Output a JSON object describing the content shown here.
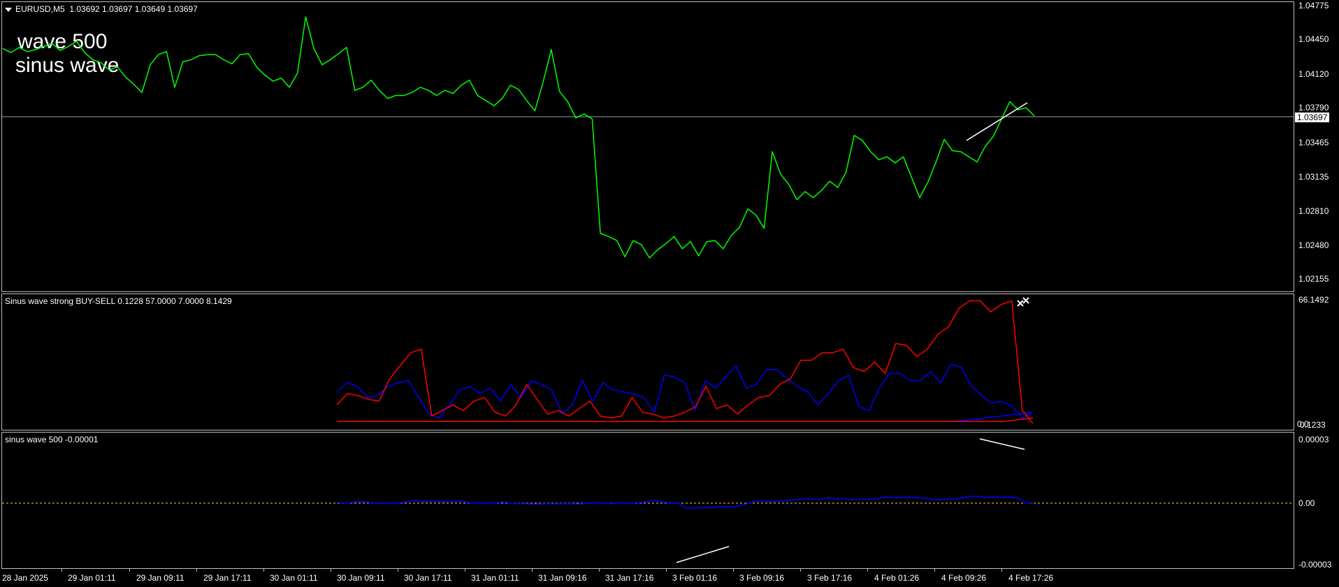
{
  "main_chart": {
    "symbol_info": "EURUSD,M5  1.03692 1.03697 1.03649 1.03697",
    "overlay_text": [
      "wave 500",
      "sinus wave"
    ],
    "current_price": "1.03697",
    "price_levels": [
      "1.04775",
      "1.04450",
      "1.04120",
      "1.03790",
      "1.03465",
      "1.03135",
      "1.02810",
      "1.02480",
      "1.02155"
    ]
  },
  "indicator_1": {
    "label": "Sinus wave strong BUY-SELL 0.1228 57.0000 7.0000 8.1429",
    "scale_top": "66.1492",
    "scale_bottom": "0.1233",
    "scale_bottom_overlap": "0.0"
  },
  "indicator_2": {
    "label": "sinus wave 500 -0.00001",
    "scale": [
      "0.00003",
      "0.00",
      "-0.00003"
    ]
  },
  "time_axis": [
    "28 Jan 2025",
    "29 Jan 01:11",
    "29 Jan 09:11",
    "29 Jan 17:11",
    "30 Jan 01:11",
    "30 Jan 09:11",
    "30 Jan 17:11",
    "31 Jan 01:11",
    "31 Jan 09:16",
    "31 Jan 17:16",
    "3 Feb 01:16",
    "3 Feb 09:16",
    "3 Feb 17:16",
    "4 Feb 01:26",
    "4 Feb 09:26",
    "4 Feb 17:26"
  ],
  "colors": {
    "price_line": "#00ff00",
    "buy_line": "#0000ff",
    "sell_line": "#ff0000",
    "sinus_line": "#0000ff",
    "zero_line": "#ffd24d",
    "grid_border": "#bfbfbf"
  },
  "chart_data": [
    {
      "type": "line",
      "title": "EURUSD,M5",
      "ylim": [
        1.0203,
        1.0478
      ],
      "series": [
        {
          "name": "EURUSD",
          "values": [
            1.0436,
            1.0432,
            1.0437,
            1.0433,
            1.0435,
            1.0438,
            1.0441,
            1.0434,
            1.0438,
            1.0443,
            1.0432,
            1.0425,
            1.0422,
            1.0415,
            1.0418,
            1.0408,
            1.0401,
            1.0393,
            1.042,
            1.043,
            1.0433,
            1.0398,
            1.0423,
            1.0425,
            1.0429,
            1.043,
            1.043,
            1.0425,
            1.0421,
            1.043,
            1.0431,
            1.0418,
            1.041,
            1.0404,
            1.0407,
            1.0398,
            1.0412,
            1.0467,
            1.0436,
            1.042,
            1.0425,
            1.0431,
            1.0437,
            1.0395,
            1.0398,
            1.0405,
            1.0395,
            1.0387,
            1.039,
            1.039,
            1.0393,
            1.0398,
            1.0395,
            1.039,
            1.0395,
            1.0392,
            1.04,
            1.0405,
            1.039,
            1.0385,
            1.038,
            1.0387,
            1.04,
            1.0396,
            1.0385,
            1.0375,
            1.0403,
            1.0435,
            1.0394,
            1.0384,
            1.0368,
            1.0372,
            1.0367,
            1.0255,
            1.0252,
            1.0248,
            1.0232,
            1.0248,
            1.0244,
            1.0231,
            1.0239,
            1.0245,
            1.0252,
            1.024,
            1.0247,
            1.0233,
            1.0247,
            1.0248,
            1.024,
            1.0253,
            1.0261,
            1.0279,
            1.0273,
            1.026,
            1.0335,
            1.0313,
            1.0303,
            1.0288,
            1.0296,
            1.029,
            1.0297,
            1.0306,
            1.03,
            1.0315,
            1.0351,
            1.0346,
            1.0335,
            1.0327,
            1.033,
            1.0324,
            1.033,
            1.031,
            1.029,
            1.0305,
            1.0325,
            1.0347,
            1.0336,
            1.0335,
            1.033,
            1.0325,
            1.034,
            1.035,
            1.0367,
            1.0384,
            1.0376,
            1.0378,
            1.037
          ]
        }
      ]
    },
    {
      "type": "line",
      "title": "Sinus wave strong BUY-SELL",
      "ylim": [
        0,
        66.1492
      ],
      "series": [
        {
          "name": "blue",
          "values": [
            17,
            22,
            20,
            14,
            15,
            20,
            22,
            23,
            14,
            5,
            3,
            10,
            18,
            20,
            16,
            19,
            12,
            21,
            14,
            23,
            21,
            18,
            5,
            10,
            23,
            12,
            22,
            18,
            17,
            16,
            14,
            6,
            26,
            25,
            22,
            7,
            23,
            19,
            25,
            31,
            19,
            21,
            29,
            29,
            24,
            20,
            17,
            10,
            16,
            23,
            26,
            9,
            7,
            19,
            27,
            27,
            23,
            23,
            28,
            22,
            32,
            30,
            20,
            15,
            11,
            12,
            9,
            3,
            6
          ]
        },
        {
          "name": "red",
          "values": [
            10,
            16,
            15,
            13,
            12,
            24,
            31,
            38,
            40,
            4,
            7,
            10,
            7,
            12,
            14,
            6,
            4,
            10,
            21,
            13,
            5,
            7,
            4,
            8,
            12,
            4,
            3,
            4,
            14,
            6,
            5,
            3,
            4,
            6,
            9,
            20,
            8,
            10,
            5,
            10,
            14,
            15,
            21,
            24,
            34,
            34,
            38,
            38,
            40,
            30,
            28,
            33,
            27,
            43,
            42,
            36,
            40,
            48,
            52,
            62,
            66,
            66,
            60,
            64,
            66,
            7,
            0
          ]
        },
        {
          "name": "blue-base",
          "values": [
            1,
            1,
            1,
            1,
            1,
            1,
            1,
            1,
            1,
            1,
            1,
            1,
            1,
            1,
            1,
            1,
            1,
            1,
            1,
            1,
            1,
            1,
            1,
            1,
            1,
            1,
            1,
            1,
            1,
            1,
            1,
            1,
            1,
            1,
            1,
            1,
            1,
            1,
            1,
            1,
            2,
            3,
            4,
            5,
            6
          ]
        },
        {
          "name": "red-base",
          "values": [
            1,
            1,
            1,
            1,
            1,
            1,
            1,
            1,
            1,
            1,
            1,
            1,
            1,
            1,
            1,
            1,
            1,
            1,
            1,
            1,
            1,
            1,
            1,
            1,
            1,
            1,
            1,
            1,
            1,
            1,
            1,
            1,
            1,
            1,
            1,
            1,
            1,
            1,
            1,
            1,
            1,
            1,
            1,
            1,
            1,
            2,
            3
          ]
        }
      ]
    },
    {
      "type": "line",
      "title": "sinus wave 500",
      "ylim": [
        -3.25e-05,
        3.25e-05
      ],
      "series": [
        {
          "name": "sinus wave 500",
          "values": [
            0.0,
            -3e-07,
            2e-07,
            4e-07,
            -2e-07,
            -2e-07,
            -4e-07,
            -3e-07,
            1e-07,
            1.1e-06,
            5e-07,
            3e-07,
            5e-07,
            3e-07,
            4e-07,
            6e-07,
            -3e-07,
            -2e-07,
            -3e-07,
            -2e-07,
            2e-07,
            -5e-07,
            -6e-07,
            -7e-07,
            -8e-07,
            -6e-07,
            -7e-07,
            -6e-07,
            -6e-07,
            -8e-07,
            -4e-07,
            -2e-07,
            -3e-07,
            -6e-07,
            -2e-07,
            -4e-07,
            -1e-07,
            1e-07,
            1.1e-06,
            2e-07,
            -2e-07,
            -2e-07,
            -2.9e-06,
            -2.8e-06,
            -2.6e-06,
            -2.6e-06,
            -2.1e-06,
            -2.2e-06,
            -1.9e-06,
            -1.2e-06,
            4e-07,
            6e-07,
            3e-07,
            5e-07,
            9e-07,
            1.2e-06,
            1.6e-06,
            1.9e-06,
            1.4e-06,
            2.4e-06,
            1.8e-06,
            2e-06,
            1.4e-06,
            1.6e-06,
            1.5e-06,
            1.8e-06,
            2.8e-06,
            2.4e-06,
            2.5e-06,
            2.6e-06,
            2.4e-06,
            2e-06,
            1.3e-06,
            1.5e-06,
            1.8e-06,
            2e-06,
            2.9e-06,
            3.1e-06,
            2.6e-06,
            2.7e-06,
            2.6e-06,
            2.7e-06,
            2.3e-06,
            -4e-07,
            -7e-07
          ]
        }
      ]
    }
  ]
}
